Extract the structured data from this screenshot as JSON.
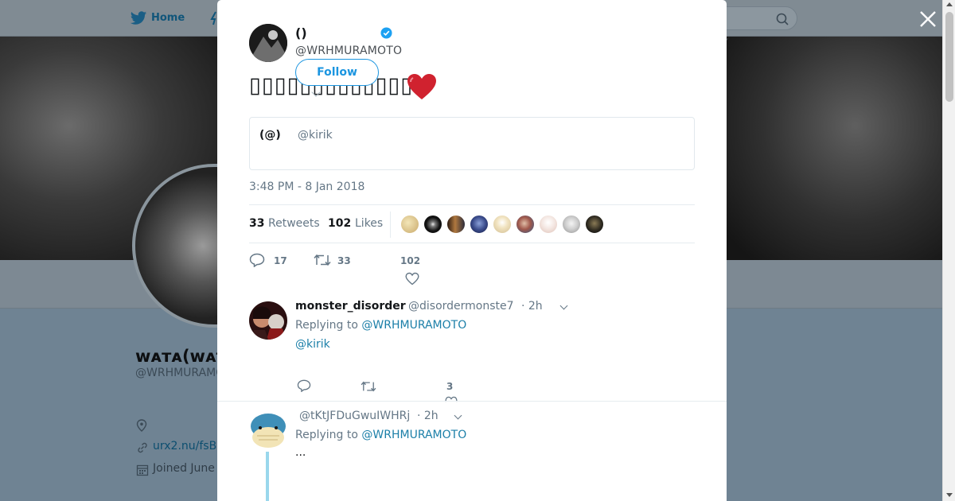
{
  "nav": {
    "home_label": "Home",
    "sort_label": "ˇ"
  },
  "background_profile": {
    "name": "ᴡᴀᴛᴀ(ᴡᴀᴛᴀ",
    "handle": "@WRHMURAMC",
    "link": "urx2.nu/fsB",
    "joined": "Joined June"
  },
  "tweet": {
    "author_name": "()",
    "author_handle": "@WRHMURAMOTO",
    "follow_label": "Follow",
    "text": "▯▯▯▯▯▯▯▯▯▯▯▯▯",
    "quote": {
      "name": "(@)",
      "handle": "@kirik"
    },
    "timestamp": "3:48 PM - 8 Jan 2018",
    "retweets_count": "33",
    "retweets_label": "Retweets",
    "likes_count": "102",
    "likes_label": "Likes",
    "reply_count": "17",
    "retweet_action_count": "33",
    "like_action_count": "102"
  },
  "replies": [
    {
      "name": "monster_disorder",
      "handle": "@disordermonste7",
      "time": "· 2h",
      "replying_prefix": "Replying to ",
      "replying_to": "@WRHMURAMOTO",
      "body": "@kirik",
      "like_count": "3"
    },
    {
      "name": "",
      "handle": "@tKtJFDuGwuIWHRj",
      "time": "· 2h",
      "replying_prefix": "Replying to ",
      "replying_to": "@WRHMURAMOTO",
      "body": "..."
    }
  ],
  "colors": {
    "accent": "#1b95e0",
    "link": "#1b7fa8",
    "heart": "#e0245e",
    "verified": "#1da1f2"
  }
}
